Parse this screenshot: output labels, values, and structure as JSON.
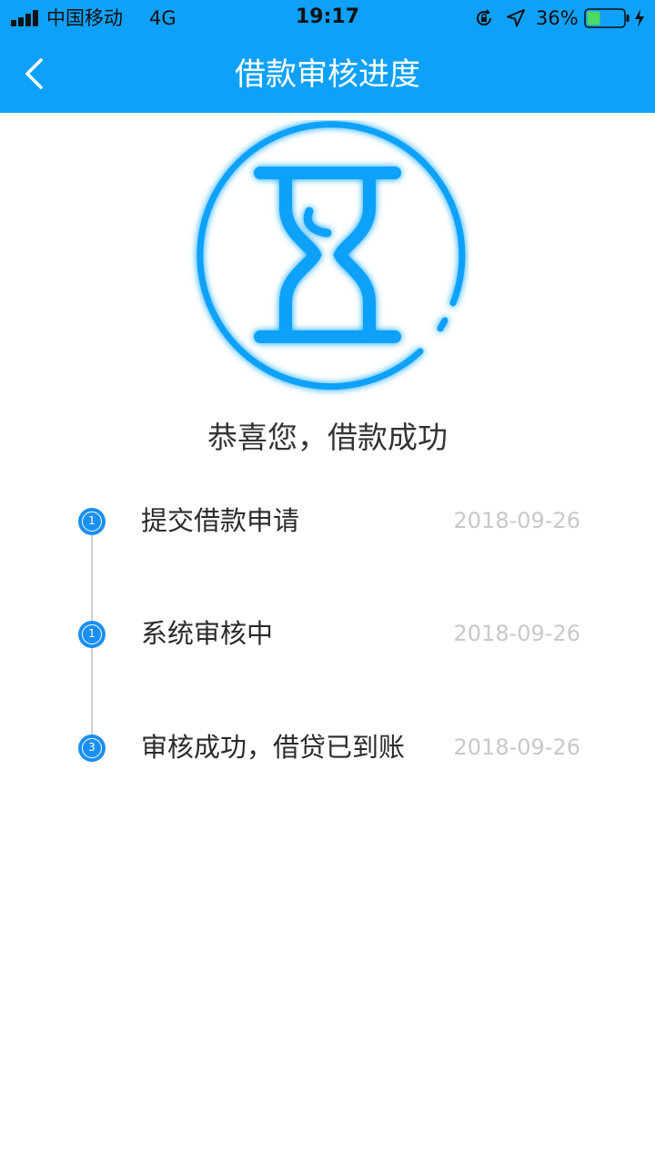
{
  "status_bar": {
    "carrier": "中国移动",
    "network": "4G",
    "time": "19:17",
    "battery_percent": "36%",
    "battery_level": 0.36,
    "lock_icon": "orientation-lock-icon",
    "location_icon": "location-arrow-icon",
    "charging_icon": "charging-bolt-icon"
  },
  "nav": {
    "title": "借款审核进度",
    "back_icon": "chevron-left-icon"
  },
  "hero": {
    "icon": "hourglass-icon",
    "message": "恭喜您，借款成功"
  },
  "timeline": {
    "steps": [
      {
        "number": "1",
        "title": "提交借款申请",
        "date": "2018-09-26"
      },
      {
        "number": "1",
        "title": "系统审核中",
        "date": "2018-09-26"
      },
      {
        "number": "3",
        "title": "审核成功，借贷已到账",
        "date": "2018-09-26"
      }
    ]
  },
  "colors": {
    "primary": "#0fa1f9",
    "step_marker": "#1a8ff2",
    "hourglass": "#0fa1f9",
    "text": "#333333",
    "date_text": "#c8c8c8",
    "timeline_line": "#cfcfcf"
  }
}
